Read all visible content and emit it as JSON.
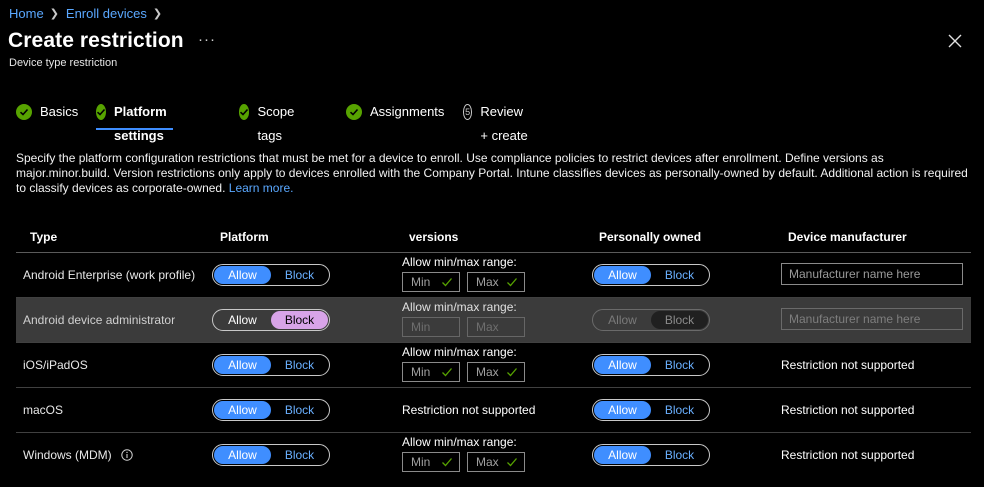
{
  "breadcrumb": {
    "home": "Home",
    "enroll": "Enroll devices",
    "sep": ">"
  },
  "header": {
    "title": "Create restriction",
    "more": "···",
    "subtitle": "Device type restriction"
  },
  "tabs": [
    {
      "label": "Basics",
      "state": "done"
    },
    {
      "label": "Platform settings",
      "state": "active"
    },
    {
      "label": "Scope tags",
      "state": "done"
    },
    {
      "label": "Assignments",
      "state": "done"
    },
    {
      "label": "Review + create",
      "state": "pending",
      "number": "5"
    }
  ],
  "description": {
    "text": "Specify the platform configuration restrictions that must be met for a device to enroll. Use compliance policies to restrict devices after enrollment. Define versions as major.minor.build. Version restrictions only apply to devices enrolled with the Company Portal. Intune classifies devices as personally-owned by default. Additional action is required to classify devices as corporate-owned.",
    "link": "Learn more."
  },
  "table": {
    "columns": [
      "Type",
      "Platform",
      "versions",
      "Personally owned",
      "Device manufacturer"
    ],
    "allow_label": "Allow",
    "block_label": "Block",
    "version_label": "Allow min/max range:",
    "min_placeholder": "Min",
    "max_placeholder": "Max",
    "not_supported": "Restriction not supported",
    "manufacturer_placeholder": "Manufacturer name here",
    "rows": [
      {
        "type": "Android Enterprise (work profile)",
        "platform": "Allow",
        "versions": "range",
        "owned": "Allow",
        "manufacturer": "input"
      },
      {
        "type": "Android device administrator",
        "platform": "Block",
        "versions": "range-disabled",
        "owned": "disabled",
        "manufacturer": "input-disabled"
      },
      {
        "type": "iOS/iPadOS",
        "platform": "Allow",
        "versions": "range",
        "owned": "Allow",
        "manufacturer": "not-supported"
      },
      {
        "type": "macOS",
        "platform": "Allow",
        "versions": "not-supported",
        "owned": "Allow",
        "manufacturer": "not-supported"
      },
      {
        "type": "Windows (MDM)",
        "platform": "Allow",
        "versions": "range",
        "owned": "Allow",
        "manufacturer": "not-supported",
        "info": true
      }
    ]
  },
  "colors": {
    "accent": "#3f8eff",
    "link": "#5aa8ff",
    "success": "#57a300",
    "block_selected": "#d8a4e8"
  }
}
